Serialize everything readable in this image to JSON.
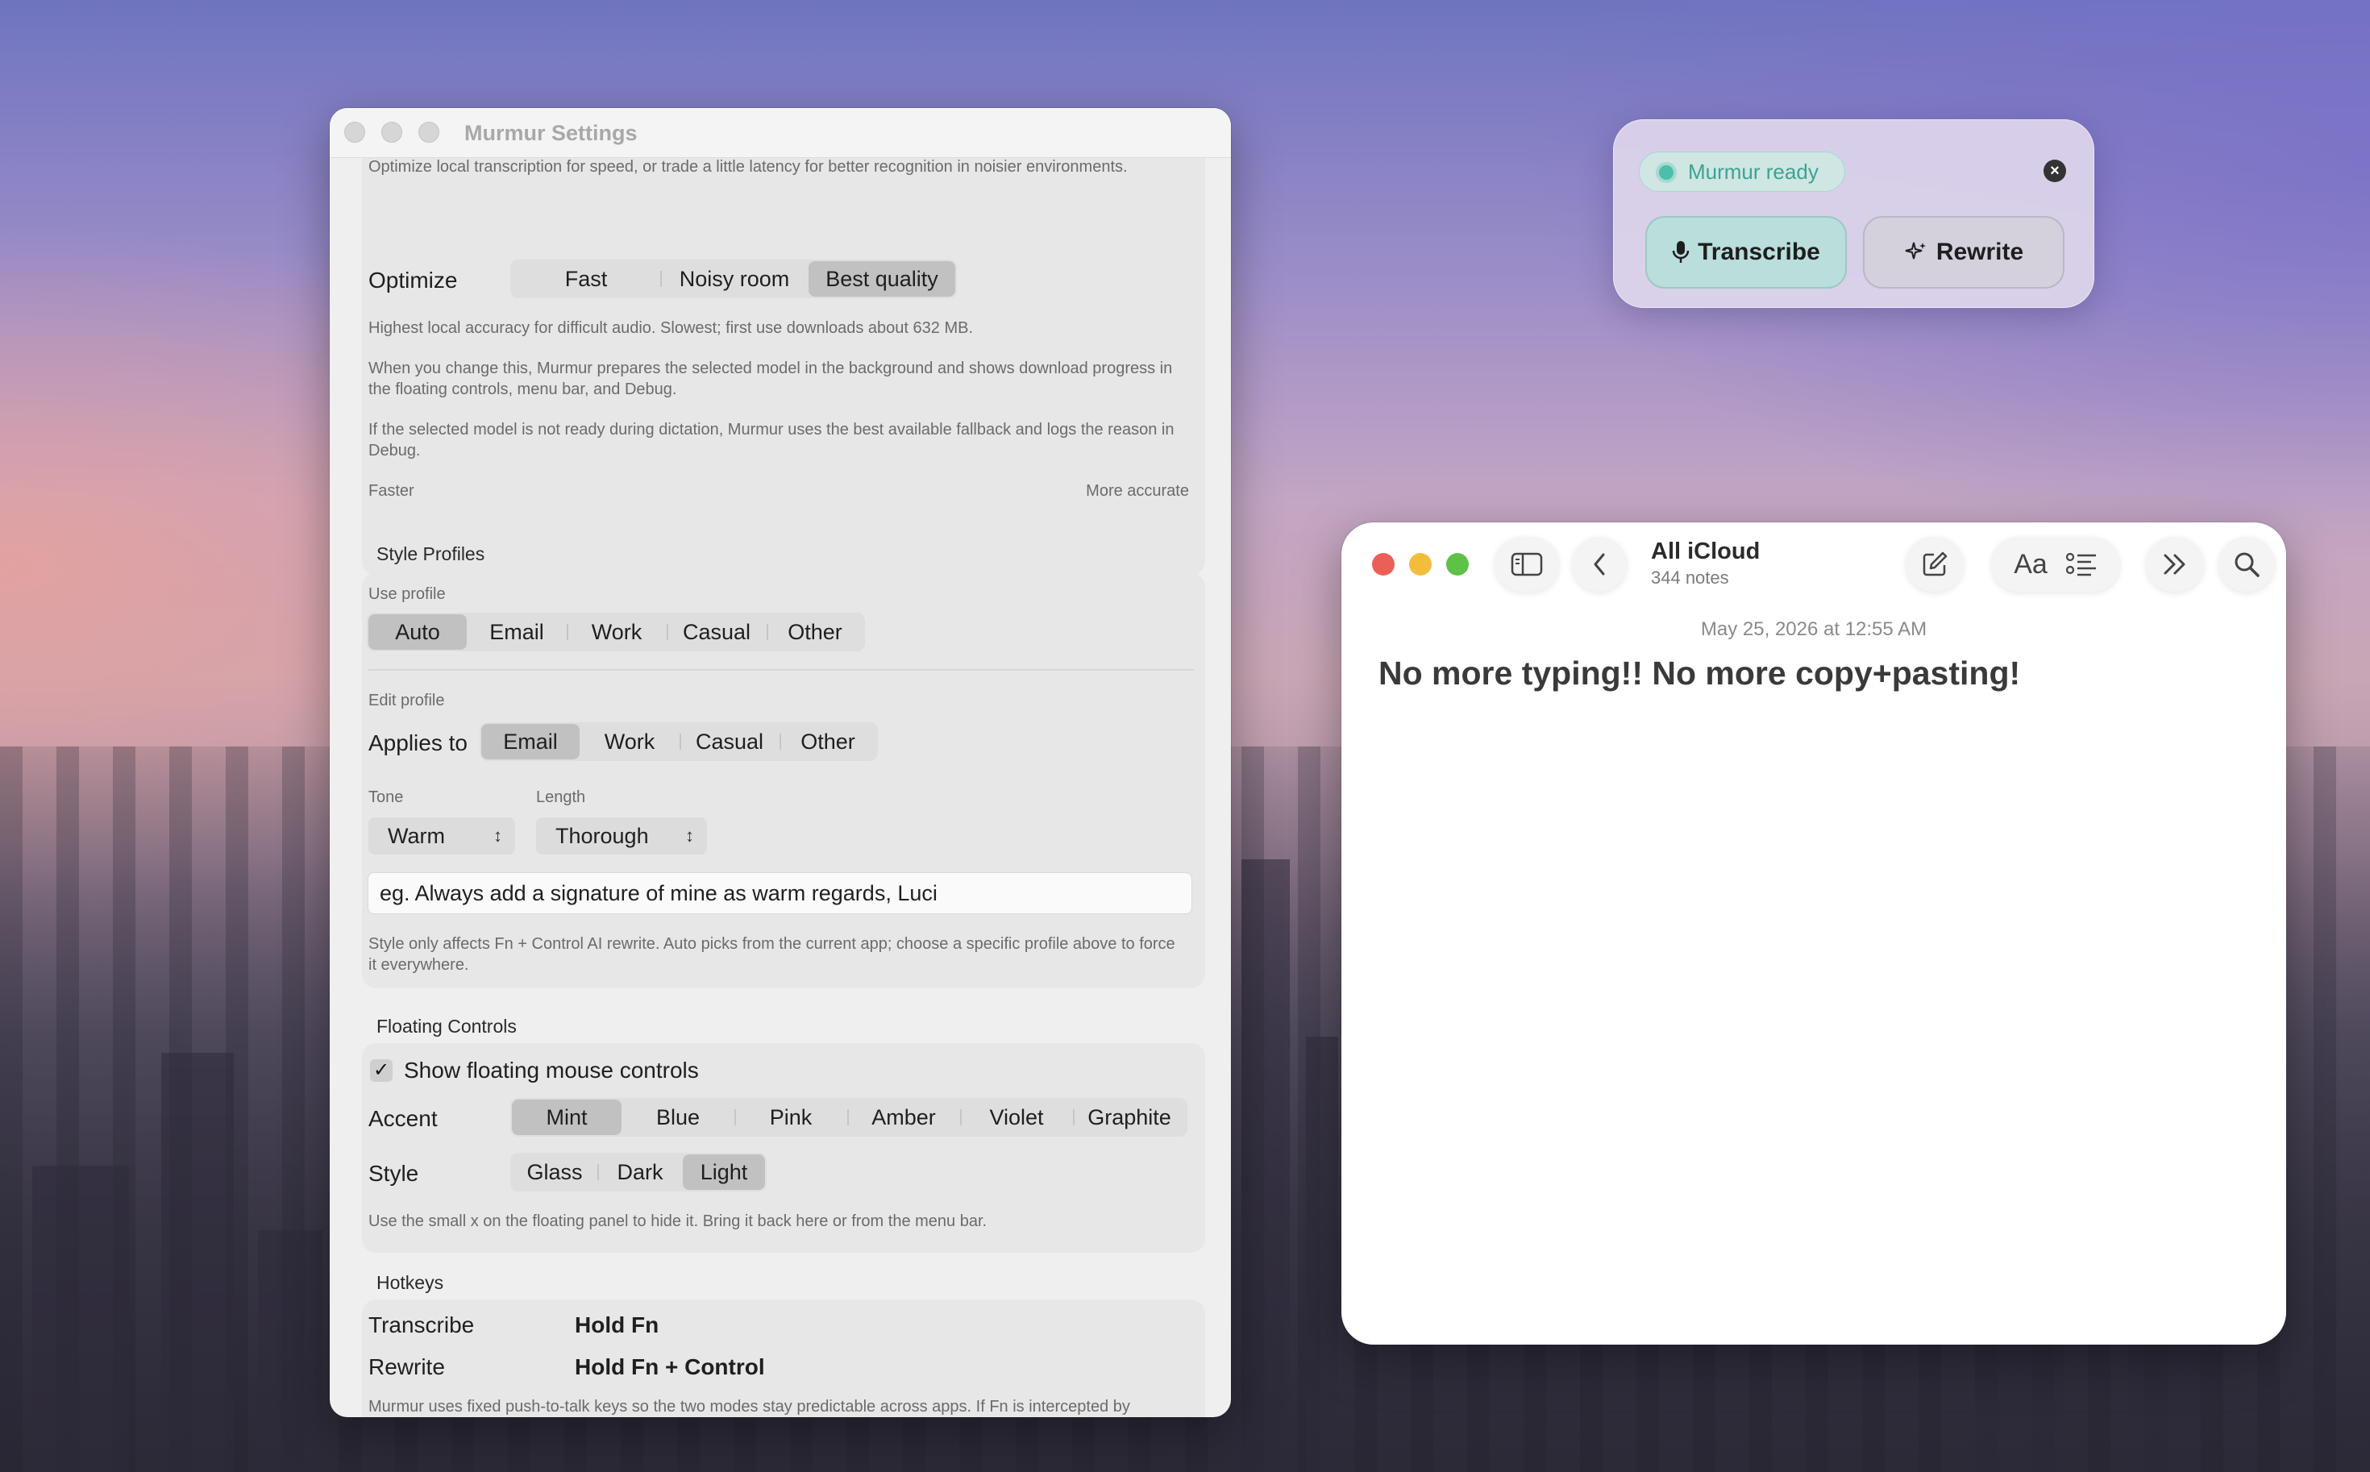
{
  "settings": {
    "window_title": "Murmur Settings",
    "model": {
      "intro": "Optimize local transcription for speed, or trade a little latency for better recognition in noisier environments.",
      "optimize_label": "Optimize",
      "options": [
        "Fast",
        "Noisy room",
        "Best quality"
      ],
      "selected": "Best quality",
      "desc1": "Highest local accuracy for difficult audio. Slowest; first use downloads about 632 MB.",
      "desc2": "When you change this, Murmur prepares the selected model in the background and shows download progress in the floating controls, menu bar, and Debug.",
      "desc3": "If the selected model is not ready during dictation, Murmur uses the best available fallback and logs the reason in Debug.",
      "faster": "Faster",
      "more_accurate": "More accurate"
    },
    "style_profiles": {
      "section": "Style Profiles",
      "use_profile_label": "Use profile",
      "use_options": [
        "Auto",
        "Email",
        "Work",
        "Casual",
        "Other"
      ],
      "use_selected": "Auto",
      "edit_profile_label": "Edit profile",
      "applies_to_label": "Applies to",
      "applies_options": [
        "Email",
        "Work",
        "Casual",
        "Other"
      ],
      "applies_selected": "Email",
      "tone_label": "Tone",
      "tone_value": "Warm",
      "length_label": "Length",
      "length_value": "Thorough",
      "instructions_value": "eg. Always add a signature of mine as warm regards, Luci",
      "note": "Style only affects Fn + Control AI rewrite. Auto picks from the current app; choose a specific profile above to force it everywhere."
    },
    "floating_controls": {
      "section": "Floating Controls",
      "show_label": "Show floating mouse controls",
      "show_checked": true,
      "accent_label": "Accent",
      "accent_options": [
        "Mint",
        "Blue",
        "Pink",
        "Amber",
        "Violet",
        "Graphite"
      ],
      "accent_selected": "Mint",
      "style_label": "Style",
      "style_options": [
        "Glass",
        "Dark",
        "Light"
      ],
      "style_selected": "Light",
      "note": "Use the small x on the floating panel to hide it. Bring it back here or from the menu bar."
    },
    "hotkeys": {
      "section": "Hotkeys",
      "transcribe_label": "Transcribe",
      "transcribe_key": "Hold Fn",
      "rewrite_label": "Rewrite",
      "rewrite_key": "Hold Fn + Control",
      "note": "Murmur uses fixed push-to-talk keys so the two modes stay predictable across apps. If Fn is intercepted by macOS, keep the floating Transcribe and Rewrite buttons enabled."
    }
  },
  "floating_panel": {
    "status": "Murmur ready",
    "transcribe_label": "Transcribe",
    "rewrite_label": "Rewrite",
    "accent_color": "#4bbfa9"
  },
  "notes": {
    "folder": "All iCloud",
    "count": "344 notes",
    "date": "May 25, 2026 at 12:55 AM",
    "title": "No more typing!! No more copy+pasting!"
  }
}
